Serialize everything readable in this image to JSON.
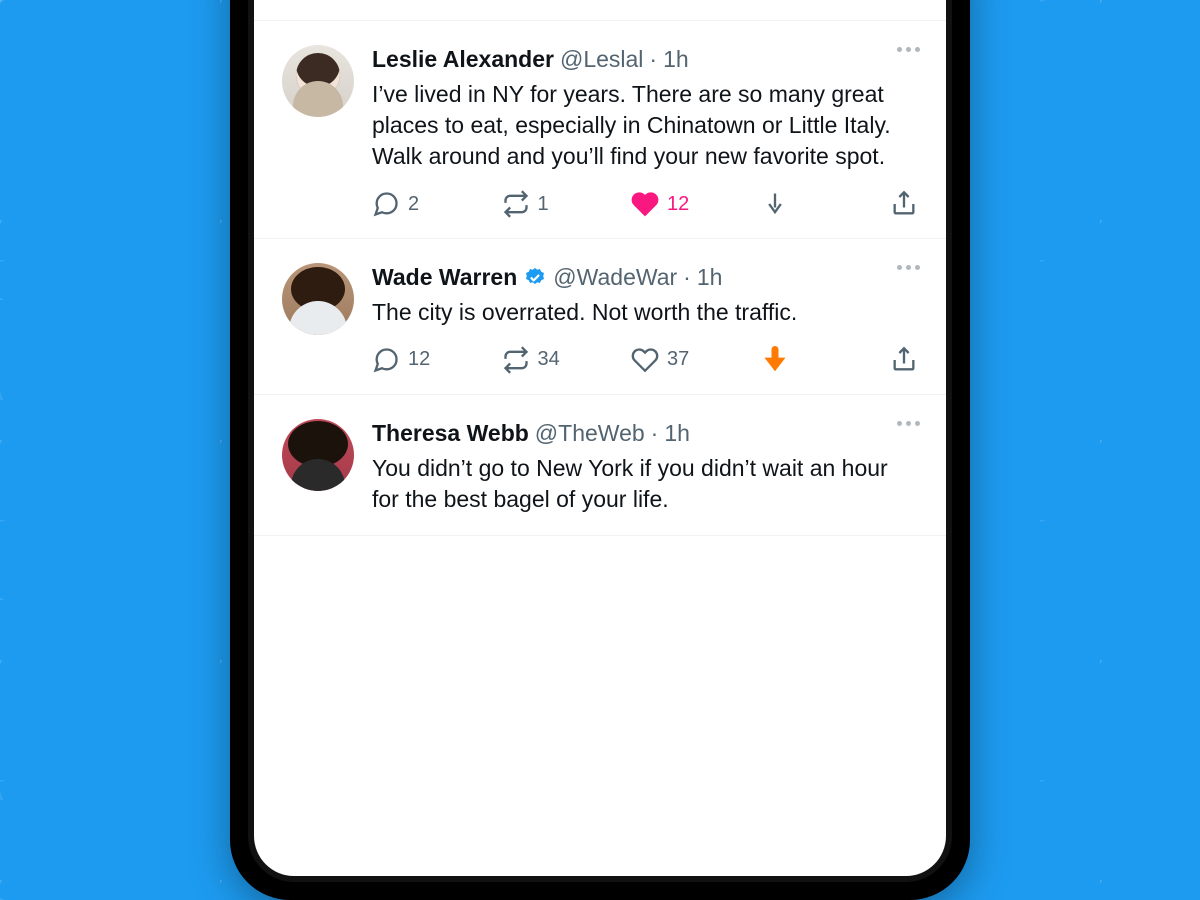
{
  "top_actions": {
    "reply": "",
    "retweet": "",
    "like": "",
    "share": ""
  },
  "tweets": [
    {
      "name": "Leslie Alexander",
      "handle": "@Leslal",
      "time": "1h",
      "verified": false,
      "text": "I’ve lived in NY for years. There are so many great places to eat, especially in Chinatown or Little Italy. Walk around and you’ll find your new favorite spot.",
      "actions": {
        "reply_count": "2",
        "retweet_count": "1",
        "like_count": "12",
        "liked": true,
        "downvoted": false,
        "downvote_count": ""
      }
    },
    {
      "name": "Wade Warren",
      "handle": "@WadeWar",
      "time": "1h",
      "verified": true,
      "text": "The city is overrated. Not worth the traffic.",
      "actions": {
        "reply_count": "12",
        "retweet_count": "34",
        "like_count": "37",
        "liked": false,
        "downvoted": true,
        "downvote_count": ""
      }
    },
    {
      "name": "Theresa Webb",
      "handle": "@TheWeb",
      "time": "1h",
      "verified": false,
      "text": "You didn’t go to New York if you didn’t wait an hour for the best bagel of your life.",
      "actions": {
        "reply_count": "",
        "retweet_count": "",
        "like_count": "",
        "liked": false,
        "downvoted": false,
        "downvote_count": ""
      }
    }
  ],
  "dot": "·"
}
